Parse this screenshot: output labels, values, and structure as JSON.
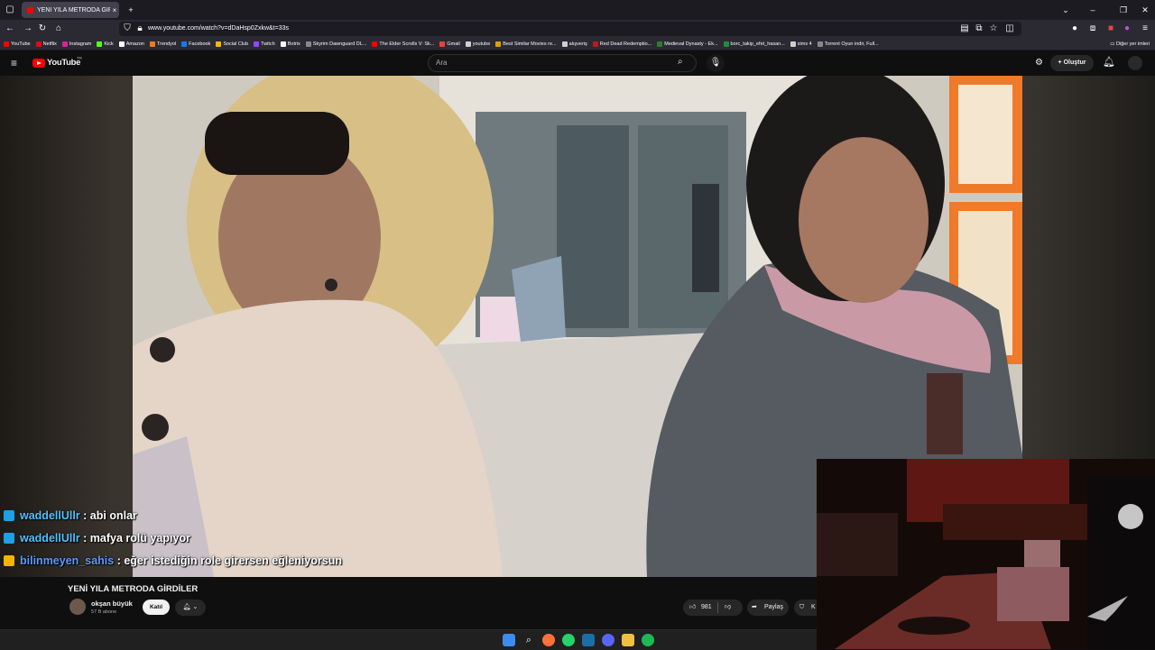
{
  "browser": {
    "tab_title": "YENİ YILA METRODA GİRDİLER",
    "tab_close": "×",
    "new_tab": "+",
    "url": "www.youtube.com/watch?v=dDaHsp0Zxkw&t=33s",
    "bookmarks": [
      {
        "label": "YouTube",
        "color": "#ff0000"
      },
      {
        "label": "Netflix",
        "color": "#e50914"
      },
      {
        "label": "Instagram",
        "color": "#d6249f"
      },
      {
        "label": "Kick",
        "color": "#53fc18"
      },
      {
        "label": "Amazon",
        "color": "#ffffff"
      },
      {
        "label": "Trendyol",
        "color": "#f27a1a"
      },
      {
        "label": "Facebook",
        "color": "#1877f2"
      },
      {
        "label": "Social Club",
        "color": "#f5b800"
      },
      {
        "label": "Twitch",
        "color": "#9146ff"
      },
      {
        "label": "Botrix",
        "color": "#ffffff"
      },
      {
        "label": "Skyrim Dawnguard DL...",
        "color": "#888888"
      },
      {
        "label": "The Elder Scrolls V: Sk...",
        "color": "#ff0000"
      },
      {
        "label": "Gmail",
        "color": "#ea4335"
      },
      {
        "label": "youtube",
        "color": "#cfcfcf"
      },
      {
        "label": "Best Similar Movies re...",
        "color": "#e0a000"
      },
      {
        "label": "alışveriş",
        "color": "#cfcfcf"
      },
      {
        "label": "Red Dead Redemptio...",
        "color": "#b71c1c"
      },
      {
        "label": "Medieval Dynasty - Ek...",
        "color": "#2e7d32"
      },
      {
        "label": "borc_takip_efet_hasan...",
        "color": "#1e8e3e"
      },
      {
        "label": "sims 4",
        "color": "#cfcfcf"
      },
      {
        "label": "Torrent Oyun indir, Full...",
        "color": "#888888"
      }
    ],
    "other_bookmarks": "Diğer yer imleri"
  },
  "youtube": {
    "logo_text": "YouTube",
    "logo_region": "TR",
    "search_placeholder": "Ara",
    "create_label": "Oluştur"
  },
  "chat": [
    {
      "user": "waddellUllr",
      "sep": " : ",
      "msg": "abi onlar"
    },
    {
      "user": "waddellUllr",
      "sep": " : ",
      "msg": "mafya rolü yapıyor"
    },
    {
      "user": "bilinmeyen_sahis",
      "sep": " : ",
      "msg": "eğer istediğin role girersen eğleniyorsun"
    }
  ],
  "video": {
    "title": "YENİ YILA METRODA GİRDİLER",
    "channel": "okşan büyük",
    "subscribers": "57 B abone",
    "join_label": "Katıl",
    "likes": "981",
    "share_label": "Paylaş",
    "save_label_partial": "K"
  },
  "colors": {
    "youtube_red": "#ff0000",
    "chat_user": "#4fc3ff",
    "background": "#0f0f0f"
  }
}
